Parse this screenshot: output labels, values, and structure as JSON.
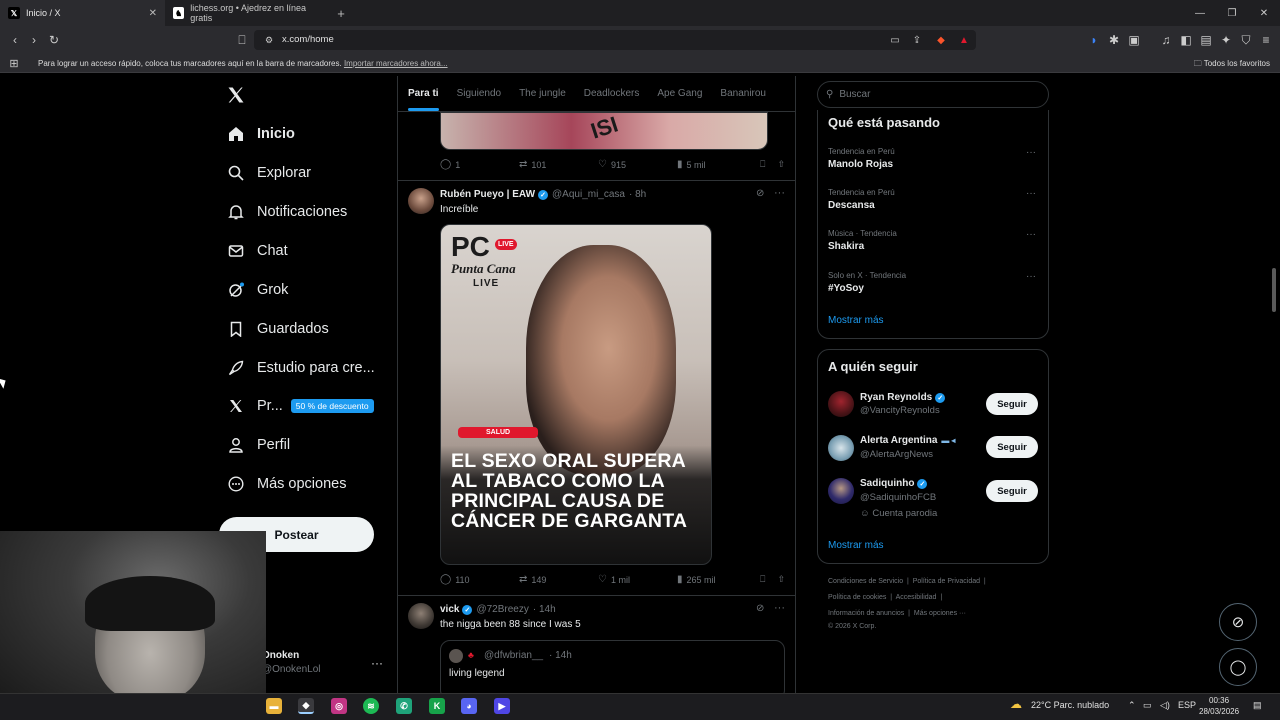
{
  "browser": {
    "tabs": [
      {
        "title": "Inicio / X",
        "favicon": "x-favicon"
      },
      {
        "title": "lichess.org • Ajedrez en línea gratis",
        "favicon": "lichess-favicon"
      }
    ],
    "url": "x.com/home",
    "bookmarks_text": "Para lograr un acceso rápido, coloca tus marcadores aquí en la barra de marcadores.",
    "bookmarks_link": "Importar marcadores ahora...",
    "all_favorites": "Todos los favoritos"
  },
  "nav": {
    "items": [
      {
        "label": "Inicio",
        "icon": "home-icon"
      },
      {
        "label": "Explorar",
        "icon": "search-icon"
      },
      {
        "label": "Notificaciones",
        "icon": "bell-icon"
      },
      {
        "label": "Chat",
        "icon": "mail-icon"
      },
      {
        "label": "Grok",
        "icon": "grok-icon"
      },
      {
        "label": "Guardados",
        "icon": "bookmark-icon"
      },
      {
        "label": "Estudio para cre...",
        "icon": "rocket-icon"
      },
      {
        "label": "Pr...",
        "icon": "x-icon"
      },
      {
        "label": "Perfil",
        "icon": "person-icon"
      },
      {
        "label": "Más opciones",
        "icon": "more-circle-icon"
      }
    ],
    "premium_badge": "50 % de descuento",
    "post_button": "Postear",
    "user": {
      "name": "Onoken",
      "handle": "@OnokenLol"
    }
  },
  "feed": {
    "tabs": [
      "Para ti",
      "Siguiendo",
      "The jungle",
      "Deadlockers",
      "Ape Gang",
      "Bananirou"
    ],
    "posts": [
      {
        "image_text": "ISI",
        "actions": {
          "replies": "1",
          "reposts": "101",
          "likes": "915",
          "views": "5 mil"
        }
      },
      {
        "author": "Rubén Pueyo | EAW",
        "handle": "@Aqui_mi_casa",
        "time": "· 8h",
        "text": "Increíble",
        "image": {
          "brand": "PC",
          "live_badge": "LIVE",
          "brand_sub": "Punta Cana",
          "brand_live": "LIVE",
          "tag": "SALUD",
          "headline": "EL SEXO ORAL SUPERA AL TABACO COMO LA PRINCIPAL CAUSA DE CÁNCER DE GARGANTA"
        },
        "actions": {
          "replies": "110",
          "reposts": "149",
          "likes": "1 mil",
          "views": "265 mil"
        }
      },
      {
        "author": "vick",
        "handle": "@72Breezy",
        "time": "· 14h",
        "text": "the nigga been 88 since I was 5",
        "quote": {
          "handle": "@dfwbrian__",
          "time": "· 14h",
          "text": "living legend"
        }
      }
    ]
  },
  "sidebar": {
    "search_placeholder": "Buscar",
    "trends_title": "Qué está pasando",
    "trends": [
      {
        "category": "Tendencia en Perú",
        "name": "Manolo Rojas"
      },
      {
        "category": "Tendencia en Perú",
        "name": "Descansa"
      },
      {
        "category": "Música · Tendencia",
        "name": "Shakira"
      },
      {
        "category": "Solo en X · Tendencia",
        "name": "#YoSoy"
      }
    ],
    "show_more": "Mostrar más",
    "follow_title": "A quién seguir",
    "follow": [
      {
        "name": "Ryan Reynolds",
        "handle": "@VancityReynolds",
        "note": ""
      },
      {
        "name": "Alerta Argentina",
        "handle": "@AlertaArgNews",
        "note": ""
      },
      {
        "name": "Sadiquinho",
        "handle": "@SadiquinhoFCB",
        "note": "Cuenta parodia"
      }
    ],
    "follow_button": "Seguir",
    "footer": {
      "line1": [
        "Condiciones de Servicio",
        "Política de Privacidad"
      ],
      "line2": [
        "Política de cookies",
        "Accesibilidad"
      ],
      "line3": [
        "Información de anuncios",
        "Más opciones ···"
      ],
      "copyright": "© 2026 X Corp."
    }
  },
  "taskbar": {
    "weather": "22°C Parc. nublado",
    "lang": "ESP",
    "time": "00:36",
    "date": "28/03/2026"
  },
  "colors": {
    "accent": "#1d9bf0",
    "bg": "#000000",
    "border": "#2f3336",
    "muted": "#71767b"
  }
}
